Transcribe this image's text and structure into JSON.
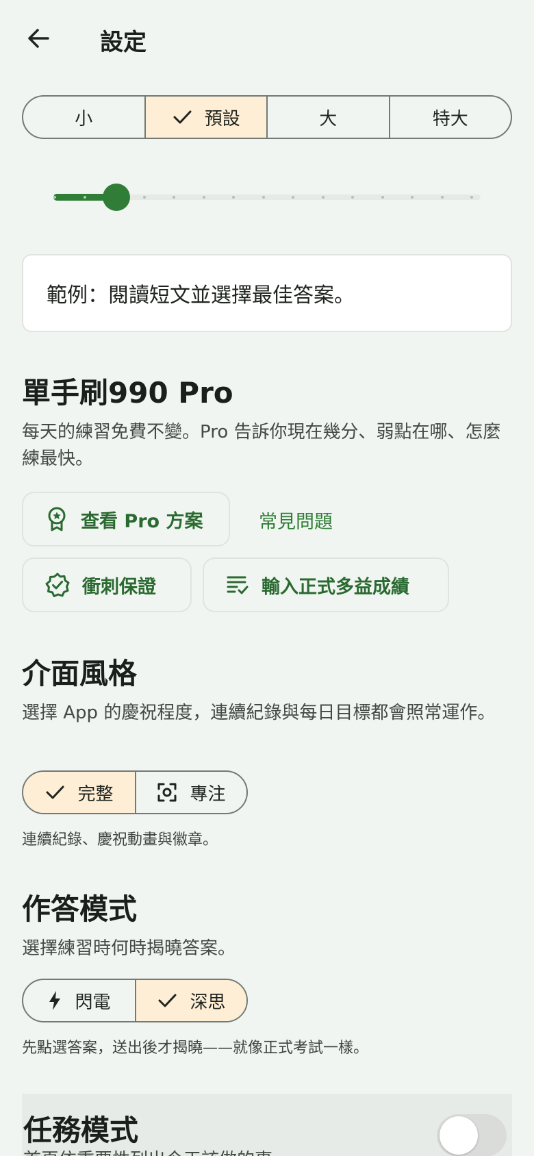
{
  "header": {
    "title": "設定"
  },
  "font_size": {
    "options": [
      {
        "label": "小",
        "selected": false
      },
      {
        "label": "預設",
        "selected": true
      },
      {
        "label": "大",
        "selected": false
      },
      {
        "label": "特大",
        "selected": false
      }
    ],
    "slider_level": 2,
    "slider_steps": 15,
    "example": "範例：閱讀短文並選擇最佳答案。"
  },
  "pro": {
    "title": "單手刷990 Pro",
    "description": "每天的練習免費不變。Pro 告訴你現在幾分、弱點在哪、怎麼練最快。",
    "view_plans": "查看 Pro 方案",
    "faq": "常見問題",
    "sprint_guarantee": "衝刺保證",
    "enter_score": "輸入正式多益成績"
  },
  "ui_style": {
    "title": "介面風格",
    "description": "選擇 App 的慶祝程度，連續紀錄與每日目標都會照常運作。",
    "options": [
      {
        "label": "完整",
        "selected": true
      },
      {
        "label": "專注",
        "selected": false
      }
    ],
    "note": "連續紀錄、慶祝動畫與徽章。"
  },
  "answer_mode": {
    "title": "作答模式",
    "description": "選擇練習時何時揭曉答案。",
    "options": [
      {
        "label": "閃電",
        "selected": false
      },
      {
        "label": "深思",
        "selected": true
      }
    ],
    "note": "先點選答案，送出後才揭曉——就像正式考試一樣。"
  },
  "task_mode": {
    "title": "任務模式",
    "description": "首頁依重要性列出今天該做的事",
    "enabled": false
  },
  "colors": {
    "background": "#f0f5f1",
    "accent_green": "#2f7d36",
    "selected_segment": "#ffeed6"
  }
}
